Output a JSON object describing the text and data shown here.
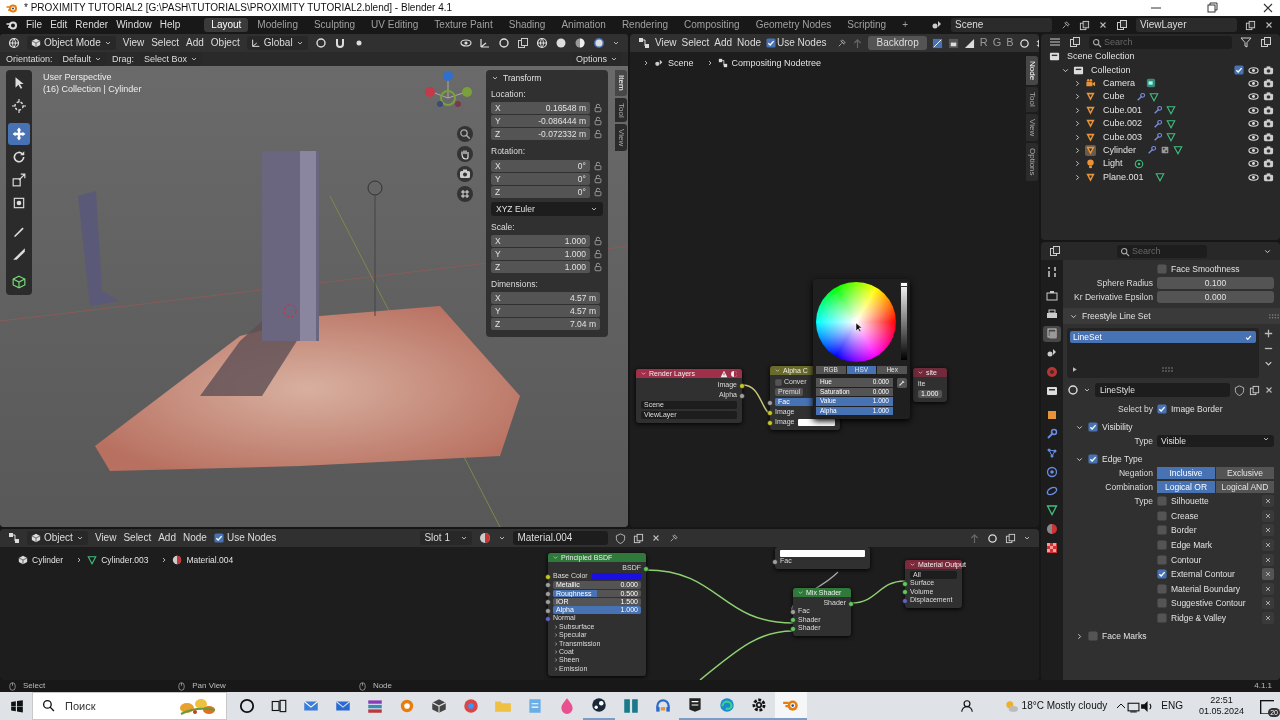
{
  "title_bar": {
    "title": "* PROXIMITY TUTORIAL2 [G:\\PASH\\TUTORIALS\\PROXIMITY TUTORIAL2.blend] - Blender 4.1"
  },
  "menus": [
    "File",
    "Edit",
    "Render",
    "Window",
    "Help"
  ],
  "workspaces": [
    {
      "label": "Layout",
      "selected": true
    },
    {
      "label": "Modeling",
      "selected": false
    },
    {
      "label": "Sculpting",
      "selected": false
    },
    {
      "label": "UV Editing",
      "selected": false
    },
    {
      "label": "Texture Paint",
      "selected": false
    },
    {
      "label": "Shading",
      "selected": false
    },
    {
      "label": "Animation",
      "selected": false
    },
    {
      "label": "Rendering",
      "selected": false
    },
    {
      "label": "Compositing",
      "selected": false
    },
    {
      "label": "Geometry Nodes",
      "selected": false
    },
    {
      "label": "Scripting",
      "selected": false
    }
  ],
  "add_workspace": "+",
  "scene": "Scene",
  "view_layer": "ViewLayer",
  "viewport": {
    "mode": "Object Mode",
    "menus": [
      "View",
      "Select",
      "Add",
      "Object"
    ],
    "orientation": "Global",
    "tool_settings": [
      {
        "kind": "label",
        "text": "Orientation:"
      },
      {
        "kind": "dropdown",
        "text": "Default"
      },
      {
        "kind": "label",
        "text": "Drag:"
      },
      {
        "kind": "dropdown",
        "text": "Select Box"
      }
    ],
    "options": "Options",
    "info": [
      "User Perspective",
      "(16) Collection | Cylinder"
    ],
    "tools": [
      {
        "kind": "select",
        "selected": false
      },
      {
        "kind": "cursor",
        "selected": false
      },
      {
        "kind": "move",
        "selected": true
      },
      {
        "kind": "rotate",
        "selected": false
      },
      {
        "kind": "scale",
        "selected": false
      },
      {
        "kind": "transform",
        "selected": false
      },
      {
        "kind": "annotate",
        "selected": false
      },
      {
        "kind": "measure",
        "selected": false
      },
      {
        "kind": "add_cube",
        "selected": false
      }
    ],
    "sidebar_tabs": [
      {
        "label": "Item",
        "selected": true
      },
      {
        "label": "Tool",
        "selected": false
      },
      {
        "label": "View",
        "selected": false
      }
    ],
    "transform": {
      "title": "Transform",
      "groups": [
        {
          "label": "Location:",
          "lockable": true,
          "rows": [
            {
              "axis": "X",
              "value": "0.16548 m"
            },
            {
              "axis": "Y",
              "value": "-0.086444 m"
            },
            {
              "axis": "Z",
              "value": "-0.072332 m"
            }
          ]
        },
        {
          "label": "Rotation:",
          "lockable": true,
          "rows": [
            {
              "axis": "X",
              "value": "0°"
            },
            {
              "axis": "Y",
              "value": "0°"
            },
            {
              "axis": "Z",
              "value": "0°"
            }
          ],
          "mode": "XYZ Euler"
        },
        {
          "label": "Scale:",
          "lockable": true,
          "rows": [
            {
              "axis": "X",
              "value": "1.000"
            },
            {
              "axis": "Y",
              "value": "1.000"
            },
            {
              "axis": "Z",
              "value": "1.000"
            }
          ]
        },
        {
          "label": "Dimensions:",
          "lockable": false,
          "rows": [
            {
              "axis": "X",
              "value": "4.57 m"
            },
            {
              "axis": "Y",
              "value": "4.57 m"
            },
            {
              "axis": "Z",
              "value": "7.04 m"
            }
          ]
        }
      ]
    }
  },
  "compositor": {
    "menus": [
      "View",
      "Select",
      "Add",
      "Node"
    ],
    "use_nodes": {
      "label": "Use Nodes",
      "checked": true
    },
    "backdrop": "Backdrop",
    "channels": [
      "R",
      "G",
      "B"
    ],
    "breadcrumb": [
      "Scene",
      "Compositing Nodetree"
    ],
    "sidebar_tabs": [
      {
        "label": "Node",
        "selected": true
      },
      {
        "label": "Tool",
        "selected": false
      },
      {
        "label": "View",
        "selected": false
      },
      {
        "label": "Options",
        "selected": false
      }
    ],
    "nodes": [
      {
        "title": "Render Layers",
        "color": "#a0304a",
        "warning": true,
        "rows": [
          {
            "kind": "output",
            "label": "Image",
            "socket": {
              "kind": "color"
            }
          },
          {
            "kind": "output",
            "label": "Alpha",
            "socket": {
              "kind": "float"
            }
          },
          {
            "kind": "select",
            "value": "Scene"
          },
          {
            "kind": "select",
            "value": "ViewLayer"
          }
        ]
      },
      {
        "title": "Alpha C",
        "color": "#6a6a2a",
        "warning": false,
        "rows": [
          {
            "kind": "check",
            "label": "Conver",
            "checked": false
          },
          {
            "kind": "button",
            "label": "Premul"
          },
          {
            "kind": "slider",
            "label": "Fac",
            "level": 1,
            "socket": {
              "kind": "float"
            }
          },
          {
            "kind": "input",
            "label": "Image",
            "socket": {
              "kind": "color"
            }
          },
          {
            "kind": "color",
            "label": "Image",
            "color": "#ffffff",
            "socket": {
              "kind": "color"
            }
          }
        ]
      },
      {
        "title": "site",
        "color": "#702a3a",
        "warning": false,
        "rows": [
          {
            "kind": "input",
            "label": "lte"
          },
          {
            "kind": "field",
            "value": "1.000"
          }
        ]
      }
    ],
    "color_picker": {
      "tabs": [
        {
          "label": "RGB",
          "selected": false
        },
        {
          "label": "HSV",
          "selected": true
        },
        {
          "label": "Hex",
          "selected": false
        }
      ],
      "fields": [
        {
          "label": "Hue",
          "value": "0.000",
          "level": 0
        },
        {
          "label": "Saturation",
          "value": "0.000",
          "level": 0
        },
        {
          "label": "Value",
          "value": "1.000",
          "level": 1
        },
        {
          "label": "Alpha",
          "value": "1.000",
          "level": 1
        }
      ],
      "brightness": {
        "level": 1
      }
    }
  },
  "shader_editor": {
    "object": "Object",
    "menus": [
      "View",
      "Select",
      "Add",
      "Node"
    ],
    "use_nodes": {
      "label": "Use Nodes",
      "checked": true
    },
    "slot": "Slot 1",
    "material": "Material.004",
    "breadcrumb": [
      "Cylinder",
      "Cylinder.003",
      "Material.004"
    ],
    "nodes": [
      {
        "title": "Principled BSDF",
        "color": "#2f7a3a",
        "rows": [
          {
            "kind": "output",
            "label": "BSDF",
            "socket": {
              "kind": "shader"
            }
          },
          {
            "kind": "color",
            "label": "Base Color",
            "color": "#1a0ee0",
            "socket": {
              "kind": "color"
            }
          },
          {
            "kind": "slider",
            "label": "Metallic",
            "value": "0.000",
            "level": 0,
            "socket": {
              "kind": "float"
            }
          },
          {
            "kind": "slider",
            "label": "Roughness",
            "value": "0.500",
            "level": 0.5,
            "socket": {
              "kind": "float"
            }
          },
          {
            "kind": "field",
            "label": "IOR",
            "value": "1.500",
            "socket": {
              "kind": "float"
            }
          },
          {
            "kind": "slider",
            "label": "Alpha",
            "value": "1.000",
            "level": 1,
            "socket": {
              "kind": "float"
            }
          },
          {
            "kind": "input",
            "label": "Normal",
            "socket": {
              "kind": "vector"
            }
          },
          {
            "kind": "panel",
            "label": "Subsurface"
          },
          {
            "kind": "panel",
            "label": "Specular"
          },
          {
            "kind": "panel",
            "label": "Transmission"
          },
          {
            "kind": "panel",
            "label": "Coat"
          },
          {
            "kind": "panel",
            "label": "Sheen"
          },
          {
            "kind": "panel",
            "label": "Emission"
          }
        ]
      },
      {
        "rows": [
          {
            "kind": "color",
            "color": "#ffffff"
          },
          {
            "kind": "input",
            "label": "Fac",
            "socket": {
              "kind": "float"
            }
          }
        ]
      },
      {
        "title": "Mix Shader",
        "color": "#2f7a3a",
        "rows": [
          {
            "kind": "output",
            "label": "Shader",
            "socket": {
              "kind": "shader"
            }
          },
          {
            "kind": "input",
            "label": "Fac",
            "socket": {
              "kind": "float"
            }
          },
          {
            "kind": "input",
            "label": "Shader",
            "socket": {
              "kind": "shader"
            }
          },
          {
            "kind": "input",
            "label": "Shader",
            "socket": {
              "kind": "shader"
            }
          }
        ]
      },
      {
        "title": "Material Output",
        "color": "#7a2a3a",
        "rows": [
          {
            "kind": "select",
            "value": "All"
          },
          {
            "kind": "input",
            "label": "Surface",
            "socket": {
              "kind": "shader"
            }
          },
          {
            "kind": "input",
            "label": "Volume",
            "socket": {
              "kind": "shader"
            }
          },
          {
            "kind": "input",
            "label": "Displacement",
            "socket": {
              "kind": "vector"
            }
          }
        ]
      }
    ]
  },
  "outliner": {
    "search": {
      "placeholder": "Search"
    },
    "tree": [
      {
        "label": "Scene Collection",
        "kind": "scene_collection",
        "children": [
          {
            "label": "Collection",
            "kind": "collection",
            "expanded": true,
            "checked": true,
            "children": [
              {
                "label": "Camera",
                "kind": "camera",
                "expanded": false,
                "active": false,
                "extras": [
                  {
                    "kind": "camera_data"
                  }
                ]
              },
              {
                "label": "Cube",
                "kind": "mesh",
                "expanded": false,
                "active": false,
                "extras": [
                  {
                    "kind": "modifier"
                  },
                  {
                    "kind": "mesh_data"
                  }
                ]
              },
              {
                "label": "Cube.001",
                "kind": "mesh",
                "expanded": false,
                "active": false,
                "extras": [
                  {
                    "kind": "modifier"
                  },
                  {
                    "kind": "mesh_data"
                  }
                ]
              },
              {
                "label": "Cube.002",
                "kind": "mesh",
                "expanded": false,
                "active": false,
                "extras": [
                  {
                    "kind": "modifier"
                  },
                  {
                    "kind": "mesh_data"
                  }
                ]
              },
              {
                "label": "Cube.003",
                "kind": "mesh",
                "expanded": false,
                "active": false,
                "extras": [
                  {
                    "kind": "modifier"
                  },
                  {
                    "kind": "mesh_data"
                  }
                ]
              },
              {
                "label": "Cylinder",
                "kind": "mesh",
                "expanded": false,
                "active": true,
                "extras": [
                  {
                    "kind": "modifier"
                  },
                  {
                    "kind": "material"
                  },
                  {
                    "kind": "mesh_data"
                  }
                ]
              },
              {
                "label": "Light",
                "kind": "light",
                "expanded": false,
                "active": false,
                "extras": [
                  {
                    "kind": "light_data"
                  }
                ]
              },
              {
                "label": "Plane.001",
                "kind": "mesh",
                "expanded": false,
                "active": false,
                "extras": [
                  {
                    "kind": "mesh_data"
                  }
                ]
              }
            ]
          }
        ]
      }
    ]
  },
  "properties": {
    "search": {
      "placeholder": "Search"
    },
    "tabs": [
      {
        "kind": "tool",
        "selected": false
      },
      {
        "kind": "render",
        "selected": false
      },
      {
        "kind": "output",
        "selected": false
      },
      {
        "kind": "view_layer",
        "selected": true
      },
      {
        "kind": "scene",
        "selected": false
      },
      {
        "kind": "world",
        "selected": false
      },
      {
        "kind": "collection",
        "selected": false
      },
      {
        "kind": "object",
        "selected": false
      },
      {
        "kind": "modifier",
        "selected": false
      },
      {
        "kind": "particles",
        "selected": false
      },
      {
        "kind": "physics",
        "selected": false
      },
      {
        "kind": "constraints",
        "selected": false
      },
      {
        "kind": "data",
        "selected": false
      },
      {
        "kind": "material",
        "selected": false
      },
      {
        "kind": "texture",
        "selected": false
      }
    ],
    "items": [
      {
        "kind": "checkbox",
        "label": "Face Smoothness",
        "checked": false
      },
      {
        "kind": "field",
        "label": "Sphere Radius",
        "value": "0.100"
      },
      {
        "kind": "field",
        "label": "Kr Derivative Epsilon",
        "value": "0.000"
      },
      {
        "kind": "section",
        "label": "Freestyle Line Set",
        "expanded": true
      },
      {
        "kind": "list",
        "items": [
          {
            "label": "LineSet",
            "checked": true,
            "selected": true
          }
        ]
      },
      {
        "kind": "datablock",
        "value": "LineStyle"
      },
      {
        "kind": "checkbox",
        "prefix": "Select by",
        "label": "Image Border",
        "checked": true
      },
      {
        "kind": "subsection",
        "label": "Visibility",
        "checked": true,
        "expanded": true
      },
      {
        "kind": "dropdown",
        "label": "Type",
        "value": "Visible"
      },
      {
        "kind": "subsection",
        "label": "Edge Type",
        "checked": true,
        "expanded": true
      },
      {
        "kind": "toggle",
        "label": "Negation",
        "options": [
          {
            "label": "Inclusive",
            "selected": true
          },
          {
            "label": "Exclusive",
            "selected": false
          }
        ]
      },
      {
        "kind": "toggle",
        "label": "Combination",
        "options": [
          {
            "label": "Logical OR",
            "selected": true
          },
          {
            "label": "Logical AND",
            "selected": false
          }
        ]
      },
      {
        "kind": "edge_types",
        "label": "Type",
        "items": [
          {
            "label": "Silhouette",
            "checked": false
          },
          {
            "label": "Crease",
            "checked": false
          },
          {
            "label": "Border",
            "checked": false
          },
          {
            "label": "Edge Mark",
            "checked": false
          },
          {
            "label": "Contour",
            "checked": false
          },
          {
            "label": "External Contour",
            "checked": true
          },
          {
            "label": "Material Boundary",
            "checked": false
          },
          {
            "label": "Suggestive Contour",
            "checked": false
          },
          {
            "label": "Ridge & Valley",
            "checked": false
          }
        ]
      },
      {
        "kind": "subsection",
        "label": "Face Marks",
        "checked": false,
        "expanded": false
      }
    ]
  },
  "status_bar": {
    "hints": [
      "Select",
      "Pan View",
      "Node"
    ],
    "version": "4.1.1"
  },
  "taskbar": {
    "search": {
      "placeholder": "Поиск"
    },
    "apps": [
      {
        "kind": "cortana",
        "open": false,
        "active": false
      },
      {
        "kind": "task_view",
        "open": false,
        "active": false
      },
      {
        "kind": "mail",
        "open": false,
        "active": false
      },
      {
        "kind": "envelope",
        "open": false,
        "active": false
      },
      {
        "kind": "archive",
        "open": false,
        "active": false
      },
      {
        "kind": "blender_old",
        "open": false,
        "active": false
      },
      {
        "kind": "cube",
        "open": false,
        "active": false
      },
      {
        "kind": "browser",
        "open": false,
        "active": false
      },
      {
        "kind": "folder",
        "open": false,
        "active": false
      },
      {
        "kind": "notepad",
        "open": false,
        "active": false
      },
      {
        "kind": "drop",
        "open": false,
        "active": false
      },
      {
        "kind": "steam",
        "open": true,
        "active": false
      },
      {
        "kind": "reader",
        "open": false,
        "active": false
      },
      {
        "kind": "headset",
        "open": false,
        "active": false
      },
      {
        "kind": "epic",
        "open": true,
        "active": false
      },
      {
        "kind": "edge",
        "open": true,
        "active": false
      },
      {
        "kind": "settings",
        "open": true,
        "active": false
      },
      {
        "kind": "blender",
        "open": true,
        "active": true
      }
    ],
    "weather": "18°C Mostly cloudy",
    "language": "ENG",
    "time": "22:51",
    "date": "01.05.2024",
    "notifications": "20"
  }
}
